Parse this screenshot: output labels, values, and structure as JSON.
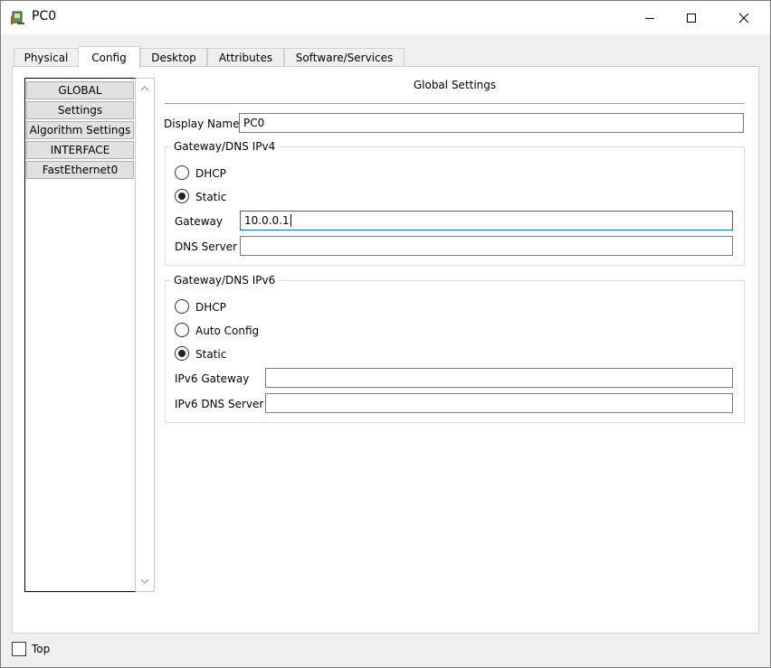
{
  "window": {
    "title": "PC0"
  },
  "tabs": [
    {
      "label": "Physical"
    },
    {
      "label": "Config"
    },
    {
      "label": "Desktop"
    },
    {
      "label": "Attributes"
    },
    {
      "label": "Software/Services"
    }
  ],
  "active_tab": "Config",
  "sidebar": {
    "items": [
      {
        "label": "GLOBAL"
      },
      {
        "label": "Settings"
      },
      {
        "label": "Algorithm Settings"
      },
      {
        "label": "INTERFACE"
      },
      {
        "label": "FastEthernet0"
      }
    ]
  },
  "global_settings": {
    "title": "Global Settings",
    "display_name_label": "Display Name",
    "display_name_value": "PC0",
    "ipv4": {
      "legend": "Gateway/DNS IPv4",
      "dhcp_label": "DHCP",
      "static_label": "Static",
      "selected": "Static",
      "gateway_label": "Gateway",
      "gateway_value": "10.0.0.1",
      "dns_label": "DNS Server",
      "dns_value": ""
    },
    "ipv6": {
      "legend": "Gateway/DNS IPv6",
      "dhcp_label": "DHCP",
      "auto_label": "Auto Config",
      "static_label": "Static",
      "selected": "Static",
      "gateway_label": "IPv6 Gateway",
      "gateway_value": "",
      "dns_label": "IPv6 DNS Server",
      "dns_value": ""
    }
  },
  "footer": {
    "top_label": "Top",
    "top_checked": false
  }
}
